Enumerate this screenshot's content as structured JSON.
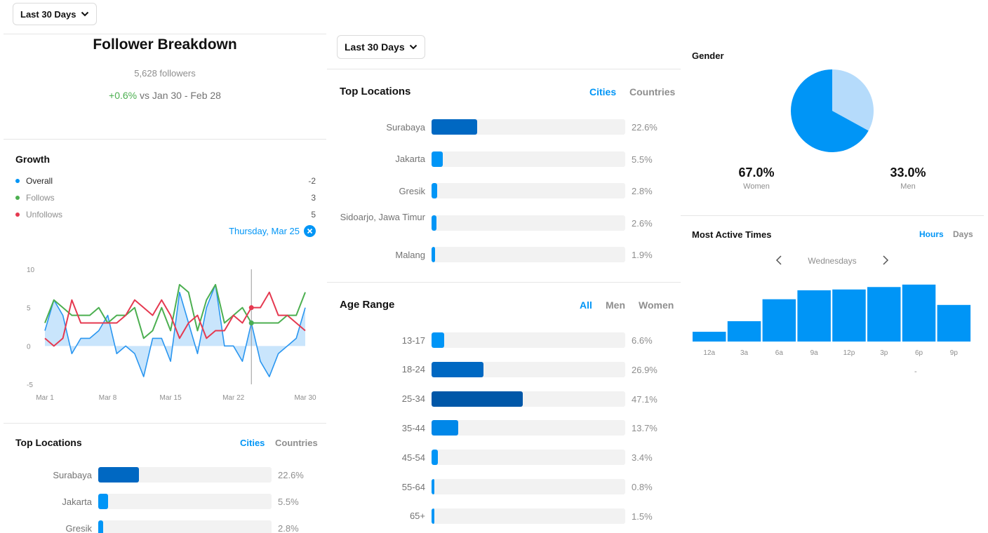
{
  "left": {
    "range_label": "Last 30 Days",
    "title": "Follower Breakdown",
    "followers": "5,628 followers",
    "change": "+0.6%",
    "change_suffix": "vs Jan 30 - Feb 28",
    "growth": {
      "title": "Growth",
      "legend": [
        {
          "label": "Overall",
          "value": "-2",
          "color": "#0095f6"
        },
        {
          "label": "Follows",
          "value": "3",
          "color": "#4caf50"
        },
        {
          "label": "Unfollows",
          "value": "5",
          "color": "#e53950"
        }
      ],
      "selected_date": "Thursday, Mar 25"
    },
    "top_locations": {
      "title": "Top Locations",
      "tabs": [
        "Cities",
        "Countries"
      ],
      "rows": [
        {
          "label": "Surabaya",
          "pct": "22.6%",
          "value": 22.6
        },
        {
          "label": "Jakarta",
          "pct": "5.5%",
          "value": 5.5
        },
        {
          "label": "Gresik",
          "pct": "2.8%",
          "value": 2.8
        }
      ]
    }
  },
  "middle": {
    "range_label": "Last 30 Days",
    "top_locations": {
      "title": "Top Locations",
      "tabs": [
        "Cities",
        "Countries"
      ],
      "rows": [
        {
          "label": "Surabaya",
          "pct": "22.6%",
          "value": 22.6
        },
        {
          "label": "Jakarta",
          "pct": "5.5%",
          "value": 5.5
        },
        {
          "label": "Gresik",
          "pct": "2.8%",
          "value": 2.8
        },
        {
          "label": "Sidoarjo, Jawa Timur",
          "pct": "2.6%",
          "value": 2.6
        },
        {
          "label": "Malang",
          "pct": "1.9%",
          "value": 1.9
        }
      ]
    },
    "age_range": {
      "title": "Age Range",
      "tabs": [
        "All",
        "Men",
        "Women"
      ],
      "rows": [
        {
          "label": "13-17",
          "pct": "6.6%",
          "value": 6.6
        },
        {
          "label": "18-24",
          "pct": "26.9%",
          "value": 26.9
        },
        {
          "label": "25-34",
          "pct": "47.1%",
          "value": 47.1
        },
        {
          "label": "35-44",
          "pct": "13.7%",
          "value": 13.7
        },
        {
          "label": "45-54",
          "pct": "3.4%",
          "value": 3.4
        },
        {
          "label": "55-64",
          "pct": "0.8%",
          "value": 0.8
        },
        {
          "label": "65+",
          "pct": "1.5%",
          "value": 1.5
        }
      ]
    }
  },
  "right": {
    "gender": {
      "title": "Gender",
      "women_pct": "67.0%",
      "women_label": "Women",
      "men_pct": "33.0%",
      "men_label": "Men",
      "women_value": 67.0,
      "men_value": 33.0
    },
    "active_times": {
      "title": "Most Active Times",
      "tabs": [
        "Hours",
        "Days"
      ],
      "day_label": "Wednesdays",
      "footer_mark": "-"
    }
  },
  "chart_data": [
    {
      "type": "line",
      "ylim": [
        -5,
        10
      ],
      "yticks": [
        "10",
        "5",
        "0",
        "-5"
      ],
      "x_tick_labels": [
        "Mar 1",
        "Mar 8",
        "Mar 15",
        "Mar 22",
        "Mar 30"
      ],
      "x": [
        1,
        2,
        3,
        4,
        5,
        6,
        7,
        8,
        9,
        10,
        11,
        12,
        13,
        14,
        15,
        16,
        17,
        18,
        19,
        20,
        21,
        22,
        23,
        24,
        25,
        26,
        27,
        28,
        29,
        30
      ],
      "series": [
        {
          "name": "Overall",
          "color": "#0095f6",
          "values": [
            2,
            6,
            4,
            -1,
            1,
            1,
            2,
            4,
            -1,
            0,
            -1,
            -4,
            1,
            1,
            -2,
            7,
            3,
            -1,
            5,
            8,
            0,
            0,
            -2,
            3,
            -2,
            -4,
            -1,
            0,
            1,
            5
          ]
        },
        {
          "name": "Follows",
          "color": "#4caf50",
          "values": [
            3,
            6,
            5,
            4,
            4,
            4,
            5,
            3,
            4,
            4,
            5,
            1,
            2,
            5,
            2,
            8,
            7,
            2,
            6,
            8,
            3,
            4,
            5,
            3,
            3,
            3,
            3,
            4,
            4,
            7
          ]
        },
        {
          "name": "Unfollows",
          "color": "#e53950",
          "values": [
            1,
            0,
            1,
            6,
            3,
            3,
            3,
            3,
            3,
            4,
            6,
            5,
            4,
            6,
            4,
            1,
            3,
            4,
            1,
            2,
            2,
            4,
            3,
            5,
            5,
            7,
            4,
            4,
            3,
            2
          ]
        }
      ]
    },
    {
      "type": "bar",
      "categories": [
        "12a",
        "3a",
        "6a",
        "9a",
        "12p",
        "3p",
        "6p",
        "9p"
      ],
      "values": [
        12,
        25,
        52,
        63,
        64,
        67,
        70,
        45
      ],
      "ylim": [
        0,
        75
      ]
    }
  ]
}
